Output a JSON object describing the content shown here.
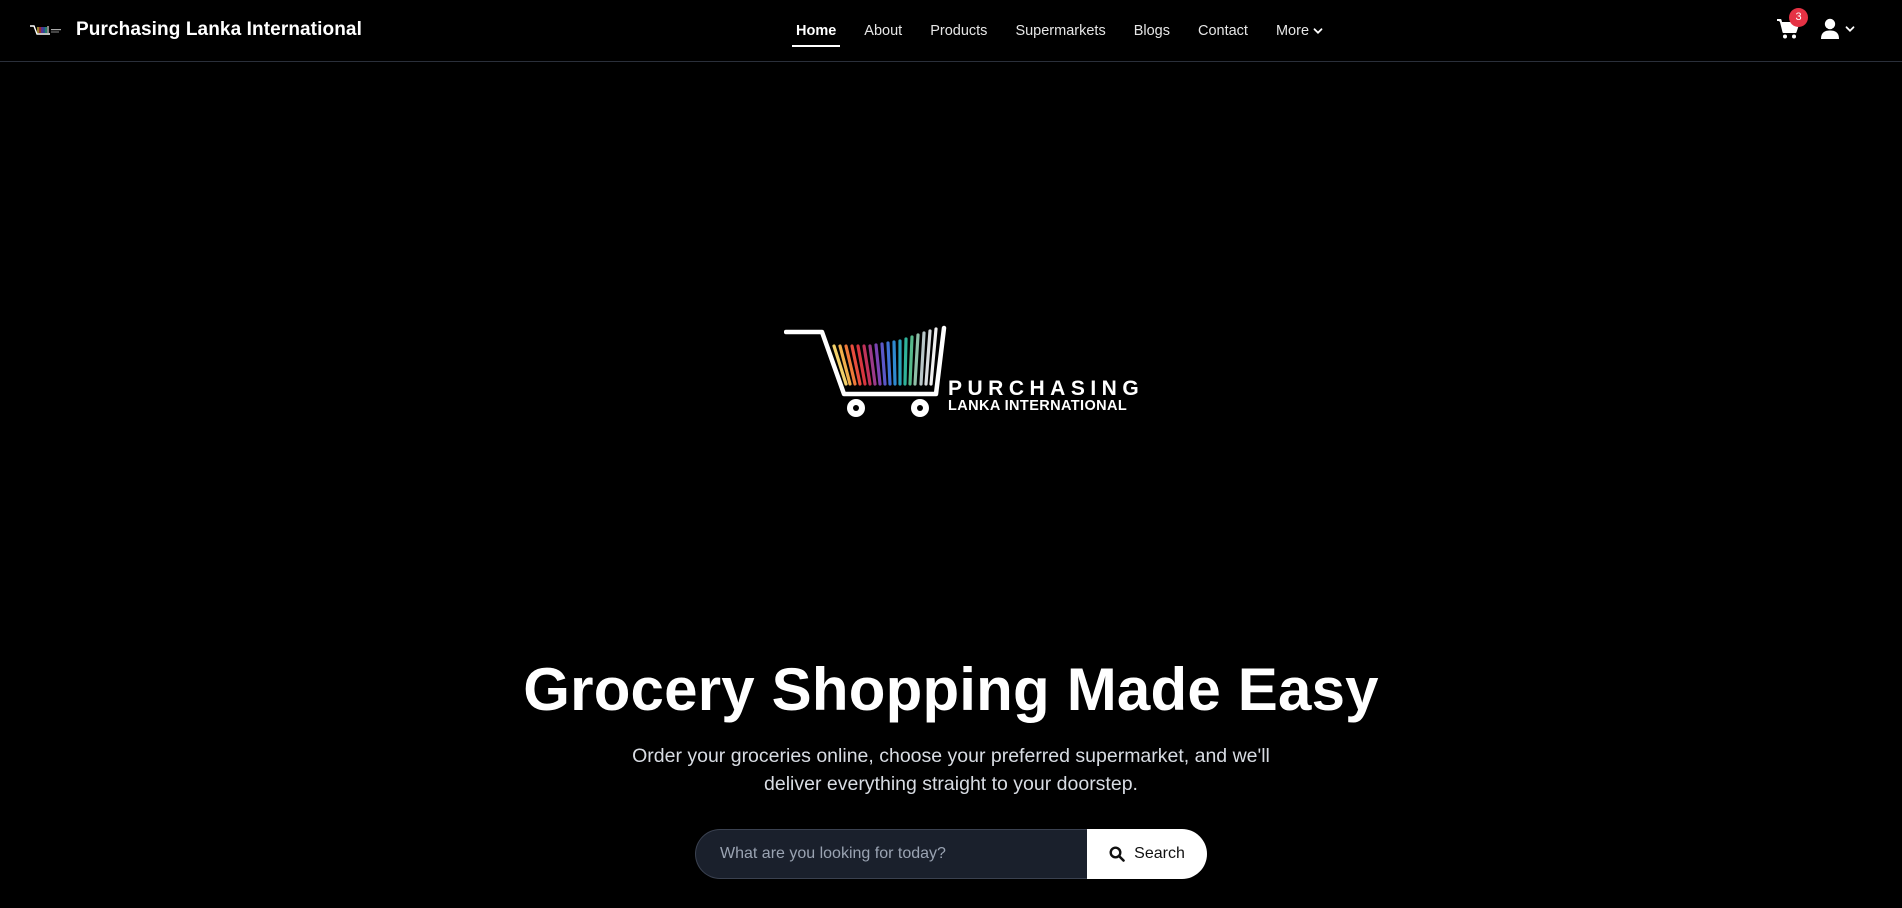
{
  "header": {
    "brand_name": "Purchasing Lanka International",
    "nav": [
      {
        "label": "Home",
        "active": true
      },
      {
        "label": "About"
      },
      {
        "label": "Products"
      },
      {
        "label": "Supermarkets"
      },
      {
        "label": "Blogs"
      },
      {
        "label": "Contact"
      },
      {
        "label": "More"
      }
    ],
    "cart_count": "3",
    "icons": {
      "cart": "shopping-cart-icon",
      "user": "user-icon",
      "more_chevron": "chevron-down-icon"
    }
  },
  "hero": {
    "logo_line1": "PURCHASING",
    "logo_line2": "LANKA INTERNATIONAL",
    "title": "Grocery Shopping Made Easy",
    "subtitle": "Order your groceries online, choose your preferred supermarket, and we'll deliver everything straight to your doorstep.",
    "search": {
      "placeholder": "What are you looking for today?",
      "button_label": "Search",
      "button_icon": "search-icon"
    }
  },
  "colors": {
    "background": "#000000",
    "badge": "#e53244",
    "search_field": "#1a202c"
  }
}
